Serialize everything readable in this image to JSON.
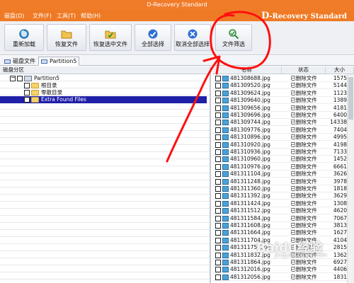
{
  "window": {
    "title": "D-Recovery Standard"
  },
  "menu": {
    "items": [
      "磁盘(D)",
      "文件(F)",
      "工具(T)",
      "帮助(H)"
    ]
  },
  "brand": {
    "d": "D",
    "rest": "-Recovery  Standard"
  },
  "toolbar": {
    "buttons": [
      {
        "label": "重新加载",
        "icon": "reload-icon"
      },
      {
        "label": "恢复文件",
        "icon": "recover-file-icon"
      },
      {
        "label": "恢复选中文件",
        "icon": "recover-selected-icon"
      },
      {
        "label": "全部选择",
        "icon": "select-all-icon"
      },
      {
        "label": "取消全部选择",
        "icon": "deselect-all-icon"
      },
      {
        "label": "文件筛选",
        "icon": "file-filter-icon"
      }
    ]
  },
  "tabs": [
    {
      "label": "磁盘文件",
      "active": false
    },
    {
      "label": "Partition5",
      "active": true
    }
  ],
  "left_pane": {
    "header": "磁盘分区",
    "tree": [
      {
        "label": "Partition5",
        "type": "drive",
        "level": 0,
        "selected": false
      },
      {
        "label": "根目录",
        "type": "folder",
        "level": 1,
        "selected": false
      },
      {
        "label": "零散目录",
        "type": "folder",
        "level": 1,
        "selected": false
      },
      {
        "label": "Extra Found Files",
        "type": "folder",
        "level": 1,
        "selected": true
      }
    ]
  },
  "right_pane": {
    "columns": {
      "name": "名称",
      "status": "状态",
      "size": "大小"
    },
    "rows": [
      {
        "name": "481308688.jpg",
        "status": "已删除文件",
        "size": "1575"
      },
      {
        "name": "481309520.jpg",
        "status": "已删除文件",
        "size": "5144"
      },
      {
        "name": "481309624.jpg",
        "status": "已删除文件",
        "size": "1123"
      },
      {
        "name": "481309640.jpg",
        "status": "已删除文件",
        "size": "1389"
      },
      {
        "name": "481309656.jpg",
        "status": "已删除文件",
        "size": "4181"
      },
      {
        "name": "481309696.jpg",
        "status": "已删除文件",
        "size": "6400"
      },
      {
        "name": "481309744.jpg",
        "status": "已删除文件",
        "size": "14338"
      },
      {
        "name": "481309776.jpg",
        "status": "已删除文件",
        "size": "7404"
      },
      {
        "name": "481310896.jpg",
        "status": "已删除文件",
        "size": "4995"
      },
      {
        "name": "481310920.jpg",
        "status": "已删除文件",
        "size": "4198"
      },
      {
        "name": "481310936.jpg",
        "status": "已删除文件",
        "size": "7133"
      },
      {
        "name": "481310960.jpg",
        "status": "已删除文件",
        "size": "1452"
      },
      {
        "name": "481310976.jpg",
        "status": "已删除文件",
        "size": "6661"
      },
      {
        "name": "481311104.jpg",
        "status": "已删除文件",
        "size": "3626"
      },
      {
        "name": "481311248.jpg",
        "status": "已删除文件",
        "size": "3978"
      },
      {
        "name": "481311360.jpg",
        "status": "已删除文件",
        "size": "1818"
      },
      {
        "name": "481311392.jpg",
        "status": "已删除文件",
        "size": "3629"
      },
      {
        "name": "481311424.jpg",
        "status": "已删除文件",
        "size": "1308"
      },
      {
        "name": "481311512.jpg",
        "status": "已删除文件",
        "size": "4620"
      },
      {
        "name": "481311584.jpg",
        "status": "已删除文件",
        "size": "7067"
      },
      {
        "name": "481311608.jpg",
        "status": "已删除文件",
        "size": "3813"
      },
      {
        "name": "481311664.jpg",
        "status": "已删除文件",
        "size": "1627"
      },
      {
        "name": "481311704.jpg",
        "status": "已删除文件",
        "size": "4104"
      },
      {
        "name": "481311759.jpg",
        "status": "已删除文件",
        "size": "2815"
      },
      {
        "name": "481311832.jpg",
        "status": "已删除文件",
        "size": "1362"
      },
      {
        "name": "481311864.jpg",
        "status": "已删除文件",
        "size": "6927"
      },
      {
        "name": "481312016.jpg",
        "status": "已删除文件",
        "size": "4406"
      },
      {
        "name": "481312056.jpg",
        "status": "已删除文件",
        "size": "1831"
      }
    ]
  },
  "watermark": {
    "text": "Baidu经验",
    "sub": "jingyan.baidu.com"
  },
  "colors": {
    "accent": "#ef7a25",
    "selection": "#1f1fa8",
    "annotation": "#ff1010"
  }
}
